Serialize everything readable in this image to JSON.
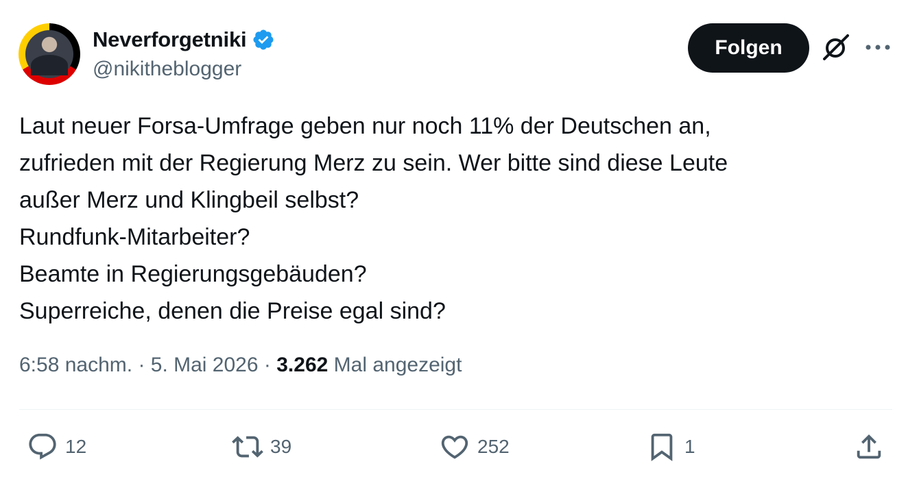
{
  "author": {
    "display_name": "Neverforgetniki",
    "handle": "@nikitheblogger",
    "verified_icon": "verified-badge-icon",
    "avatar_ring_colors": [
      "#000000",
      "#dd0000",
      "#ffce00"
    ]
  },
  "header_actions": {
    "follow_label": "Folgen",
    "grok_icon": "grok-icon",
    "more_icon": "more-icon"
  },
  "tweet": {
    "lines": [
      "Laut neuer Forsa-Umfrage geben nur noch 11% der Deutschen an,",
      "zufrieden mit der Regierung Merz zu sein. Wer bitte sind diese Leute",
      "außer Merz und Klingbeil selbst?",
      "Rundfunk-Mitarbeiter?",
      "Beamte in Regierungsgebäuden?",
      "Superreiche, denen die Preise egal sind?"
    ]
  },
  "meta": {
    "time": "6:58 nachm.",
    "separator": "·",
    "date": "5. Mai 2026",
    "views": "3.262",
    "views_label": "Mal angezeigt"
  },
  "actions": {
    "replies": "12",
    "reposts": "39",
    "likes": "252",
    "bookmarks": "1"
  },
  "colors": {
    "text_primary": "#0f1419",
    "text_secondary": "#536471",
    "verified_blue": "#1d9bf0",
    "button_bg": "#0f1419",
    "divider": "#eff3f4"
  }
}
